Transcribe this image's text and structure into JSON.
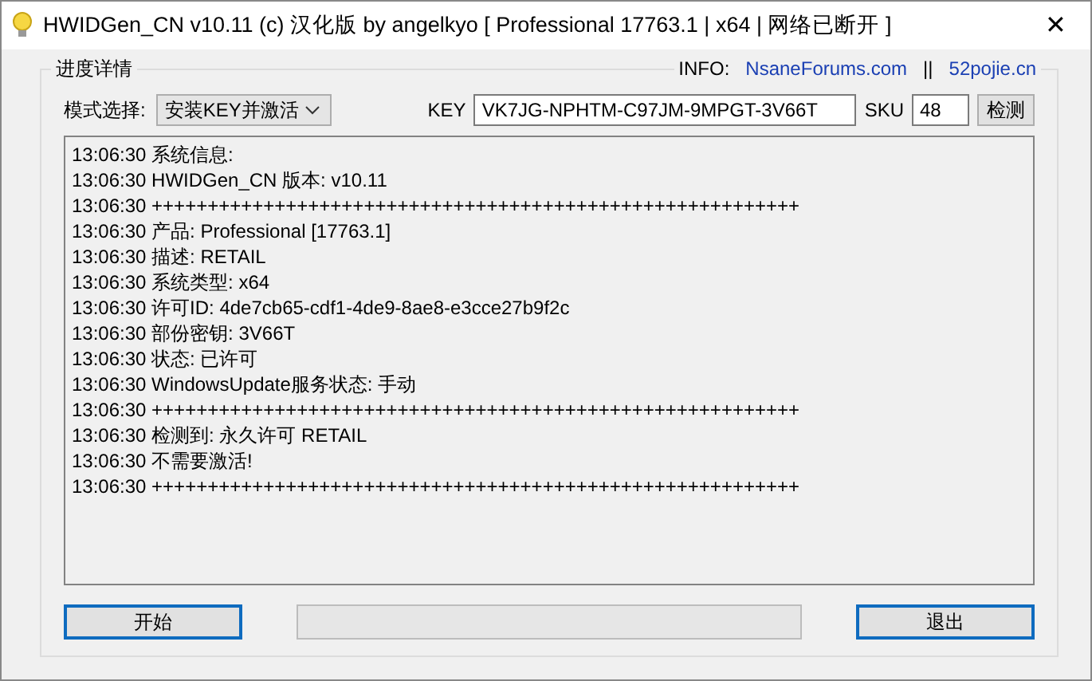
{
  "window": {
    "title": "HWIDGen_CN v10.11 (c) 汉化版 by angelkyo [ Professional 17763.1 | x64 | 网络已断开 ]",
    "close": "✕"
  },
  "group": {
    "title": "进度详情"
  },
  "info": {
    "label": "INFO:",
    "links": [
      "NsaneForums.com",
      "52pojie.cn"
    ],
    "separator": "||"
  },
  "mode": {
    "label": "模式选择:",
    "value": "安装KEY并激活"
  },
  "key": {
    "label": "KEY",
    "value": "VK7JG-NPHTM-C97JM-9MPGT-3V66T"
  },
  "sku": {
    "label": "SKU",
    "value": "48"
  },
  "check_button": "检测",
  "log": [
    "13:06:30 系统信息:",
    "13:06:30 HWIDGen_CN 版本: v10.11",
    "13:06:30 ++++++++++++++++++++++++++++++++++++++++++++++++++++++++++",
    "13:06:30 产品: Professional [17763.1]",
    "13:06:30 描述: RETAIL",
    "13:06:30 系统类型: x64",
    "13:06:30 许可ID: 4de7cb65-cdf1-4de9-8ae8-e3cce27b9f2c",
    "13:06:30 部份密钥: 3V66T",
    "13:06:30 状态: 已许可",
    "13:06:30 WindowsUpdate服务状态: 手动",
    "13:06:30 ++++++++++++++++++++++++++++++++++++++++++++++++++++++++++",
    "13:06:30 检测到:  永久许可 RETAIL",
    "13:06:30 不需要激活!",
    "13:06:30 ++++++++++++++++++++++++++++++++++++++++++++++++++++++++++"
  ],
  "start_button": "开始",
  "exit_button": "退出"
}
